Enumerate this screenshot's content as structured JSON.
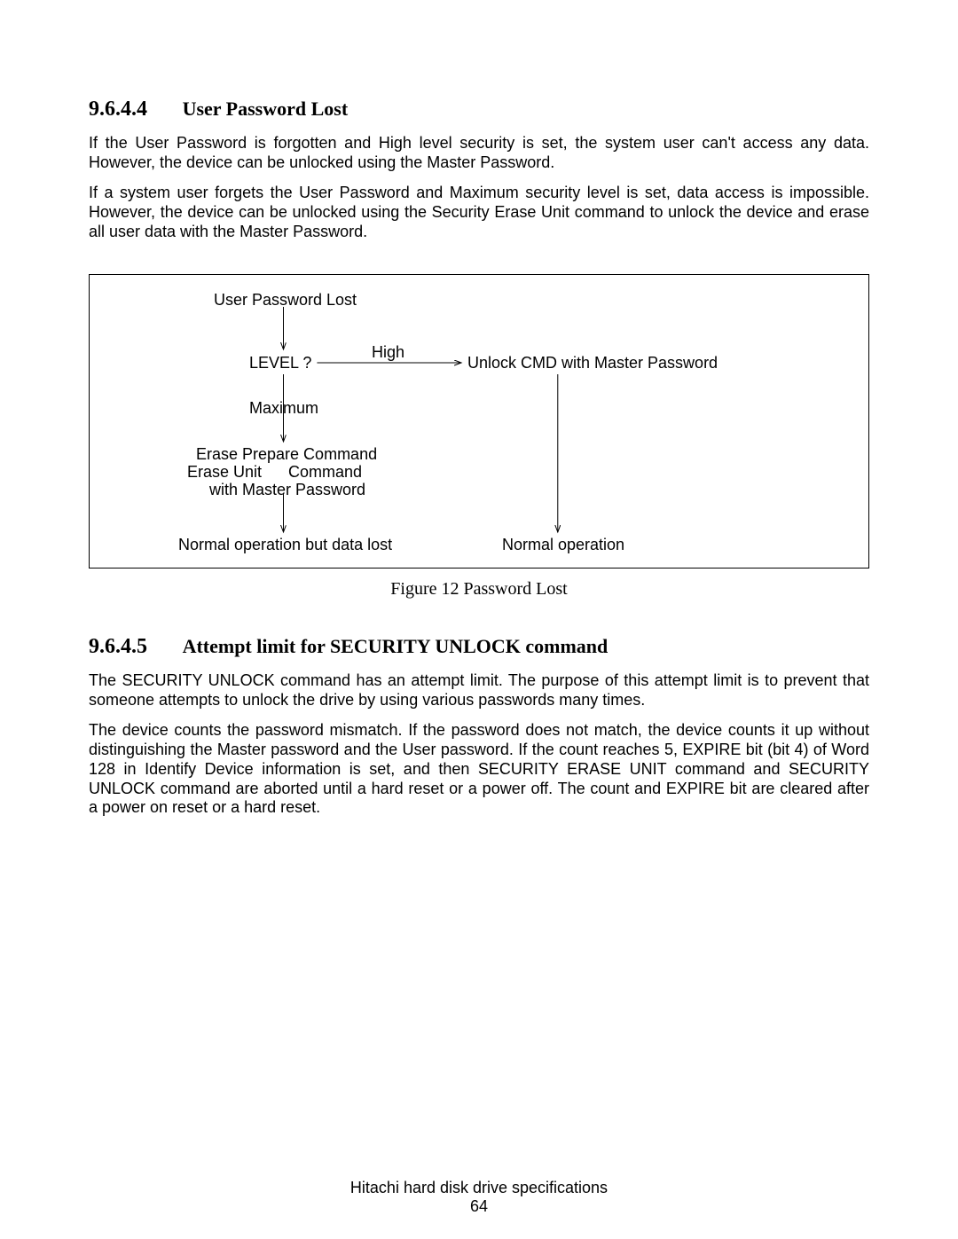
{
  "section1": {
    "number": "9.6.4.4",
    "title": "User Password Lost",
    "para1": "If the User Password is forgotten and High level security is set, the system user can't access any data. However, the device can be unlocked using the Master Password.",
    "para2": "If a system user forgets the User Password and Maximum security level is set, data access is impossible. However, the device can be unlocked using the Security Erase Unit command to unlock the device and erase all user data with the Master Password."
  },
  "figure": {
    "labels": {
      "top": "User Password Lost",
      "level": "LEVEL ?",
      "high": "High",
      "unlock": "Unlock CMD with Master Password",
      "maximum": "Maximum",
      "erase1": "Erase Prepare Command",
      "erase2": "Erase Unit      Command",
      "erase3": "with Master Password",
      "left_end": "Normal operation but data lost",
      "right_end": "Normal operation"
    },
    "caption": "Figure 12   Password Lost"
  },
  "section2": {
    "number": "9.6.4.5",
    "title": "Attempt limit for SECURITY UNLOCK command",
    "para1": "The SECURITY UNLOCK command has an attempt limit. The purpose of this attempt limit is to prevent that someone attempts to unlock the drive by using various passwords many times.",
    "para2": "The device counts the password mismatch. If the password does not match, the device counts it up without distinguishing the Master password and the User password. If the count reaches 5, EXPIRE bit (bit 4) of Word 128 in Identify Device information is set, and then SECURITY ERASE UNIT command and SECURITY UNLOCK command are aborted until a hard reset or a power off. The count and EXPIRE bit are cleared after a power on reset or a hard reset."
  },
  "footer": {
    "line1": "Hitachi hard disk drive specifications",
    "page": "64"
  }
}
